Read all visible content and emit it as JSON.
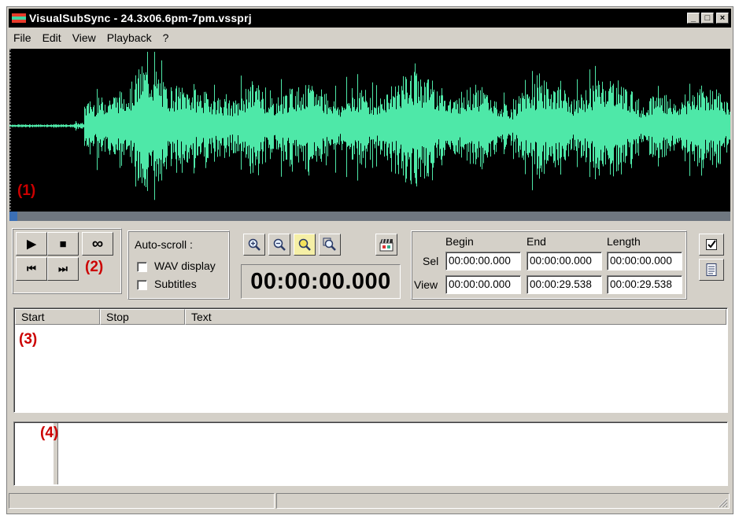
{
  "window": {
    "title": "VisualSubSync - 24.3x06.6pm-7pm.vssprj",
    "controls": {
      "minimize": "_",
      "maximize": "□",
      "close": "×"
    }
  },
  "menu": [
    "File",
    "Edit",
    "View",
    "Playback",
    "?"
  ],
  "colors": {
    "waveform": "#4ee8a8",
    "waveform_bg": "#000000",
    "marker": "#cc0000",
    "scroll_thumb": "#3b6fb5"
  },
  "markers": {
    "m1": "(1)",
    "m2": "(2)",
    "m3": "(3)",
    "m4": "(4)"
  },
  "transport": {
    "play_icon": "play-icon",
    "stop_icon": "stop-icon",
    "loop_icon": "loop-icon",
    "prev_icon": "skip-back-icon",
    "next_icon": "skip-forward-icon",
    "play": "▶",
    "stop": "■",
    "loop": "∞",
    "prev": "⏮",
    "next": "⏭"
  },
  "autoscroll": {
    "label": "Auto-scroll :",
    "wav_display": {
      "label": "WAV display",
      "checked": false
    },
    "subtitles": {
      "label": "Subtitles",
      "checked": false
    }
  },
  "zoom": {
    "icons": [
      "zoom-in-icon",
      "zoom-out-icon",
      "zoom-selection-icon",
      "zoom-all-icon"
    ]
  },
  "current_time": "00:00:00.000",
  "timing": {
    "headers": {
      "begin": "Begin",
      "end": "End",
      "length": "Length"
    },
    "sel": {
      "label": "Sel",
      "begin": "00:00:00.000",
      "end": "00:00:00.000",
      "length": "00:00:00.000"
    },
    "view": {
      "label": "View",
      "begin": "00:00:00.000",
      "end": "00:00:29.538",
      "length": "00:00:29.538"
    }
  },
  "subtitle_list": {
    "columns": [
      "Start",
      "Stop",
      "Text"
    ],
    "rows": []
  }
}
